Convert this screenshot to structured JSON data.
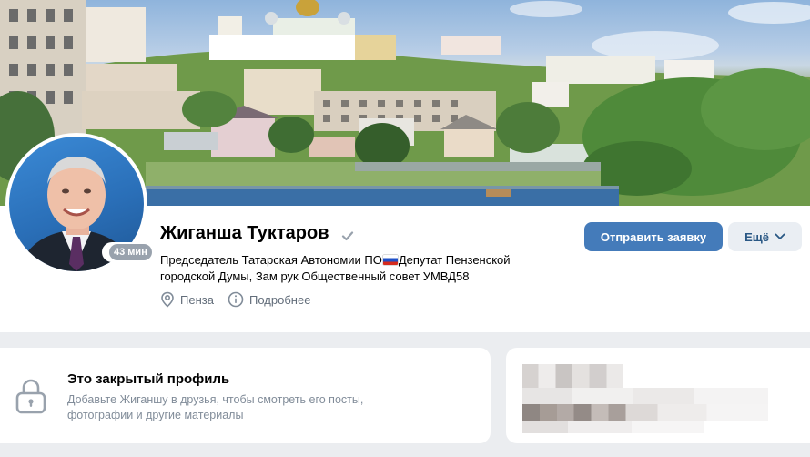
{
  "profile": {
    "name": "Жиганша Туктаров",
    "status_line1_part1": "Председатель Татарская Автономии ПО",
    "status_line1_part2": "Депутат Пензенской",
    "status_line2": "городской Думы, Зам рук Общественный совет УМВД58",
    "last_seen": "43 мин",
    "city": "Пенза",
    "more_info": "Подробнее"
  },
  "actions": {
    "send_request": "Отправить заявку",
    "more": "Ещё"
  },
  "private_profile": {
    "title": "Это закрытый профиль",
    "text_line1": "Добавьте Жиганшу в друзья, чтобы смотреть его посты,",
    "text_line2": "фотографии и другие материалы"
  },
  "colors": {
    "primary_button": "#447bba",
    "secondary_button": "#eaeef3",
    "link_text": "#2a5885",
    "muted_text": "#818c99",
    "page_background": "#ebedf0"
  },
  "icons": {
    "verified": "checkmark-icon",
    "city": "location-pin-icon",
    "more_info": "info-icon",
    "dropdown": "chevron-down-icon",
    "private": "lock-icon"
  }
}
